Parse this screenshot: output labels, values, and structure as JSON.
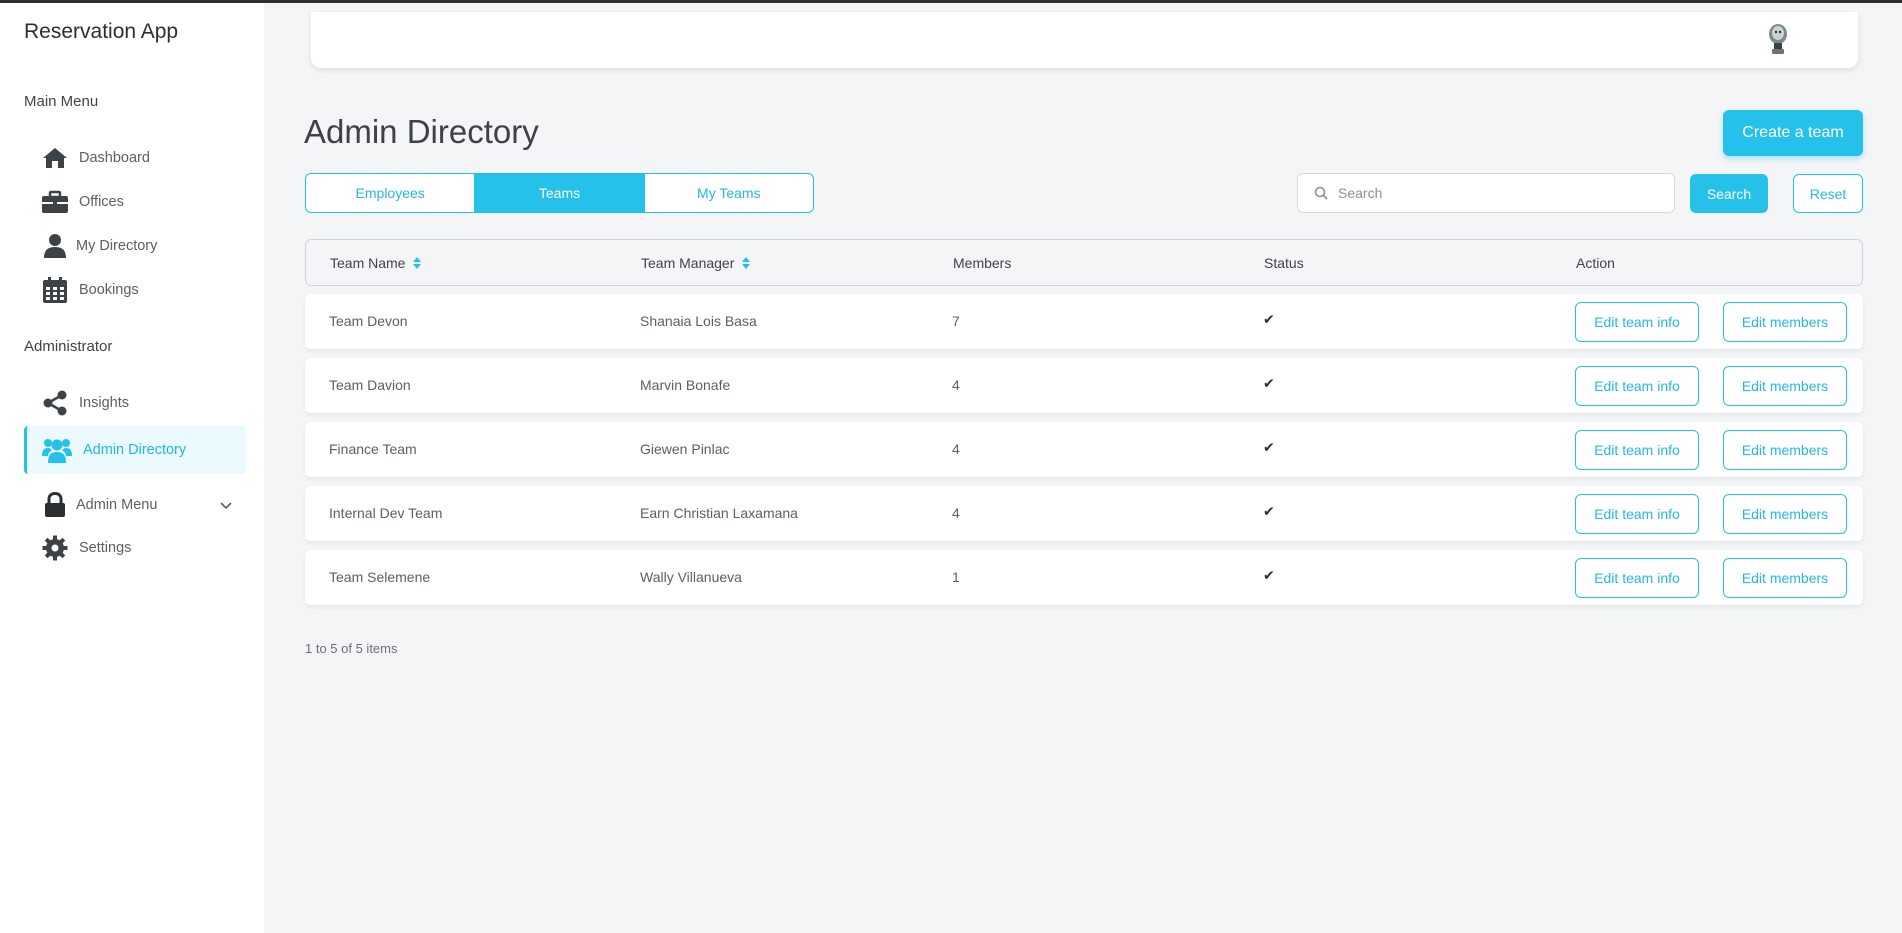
{
  "app": {
    "title": "Reservation App"
  },
  "sidebar": {
    "main_menu_label": "Main Menu",
    "main_items": [
      {
        "label": "Dashboard",
        "icon": "home-icon"
      },
      {
        "label": "Offices",
        "icon": "briefcase-icon"
      },
      {
        "label": "My Directory",
        "icon": "user-icon"
      },
      {
        "label": "Bookings",
        "icon": "calendar-icon"
      }
    ],
    "admin_label": "Administrator",
    "admin_items": [
      {
        "label": "Insights",
        "icon": "share-icon"
      },
      {
        "label": "Admin Directory",
        "icon": "users-icon",
        "active": true
      },
      {
        "label": "Admin Menu",
        "icon": "lock-icon"
      },
      {
        "label": "Settings",
        "icon": "gear-icon"
      }
    ]
  },
  "page": {
    "title": "Admin Directory",
    "create_button": "Create a team"
  },
  "tabs": [
    {
      "label": "Employees",
      "active": false
    },
    {
      "label": "Teams",
      "active": true
    },
    {
      "label": "My Teams",
      "active": false
    }
  ],
  "search": {
    "placeholder": "Search",
    "value": "",
    "button": "Search",
    "reset": "Reset"
  },
  "table": {
    "headers": {
      "team_name": "Team Name",
      "team_manager": "Team Manager",
      "members": "Members",
      "status": "Status",
      "action": "Action"
    },
    "rows": [
      {
        "team_name": "Team Devon",
        "manager": "Shanaia Lois Basa",
        "members": "7",
        "status": "✔"
      },
      {
        "team_name": "Team Davion",
        "manager": "Marvin Bonafe",
        "members": "4",
        "status": "✔"
      },
      {
        "team_name": "Finance Team",
        "manager": "Giewen Pinlac",
        "members": "4",
        "status": "✔"
      },
      {
        "team_name": "Internal Dev Team",
        "manager": "Earn Christian Laxamana",
        "members": "4",
        "status": "✔"
      },
      {
        "team_name": "Team Selemene",
        "manager": "Wally Villanueva",
        "members": "1",
        "status": "✔"
      }
    ],
    "edit_info_label": "Edit team info",
    "edit_members_label": "Edit members"
  },
  "pagination": {
    "summary": "1 to 5 of 5 items"
  },
  "colors": {
    "accent": "#25c1ea",
    "background": "#f3f5f7",
    "sidebar": "#ffffff"
  }
}
